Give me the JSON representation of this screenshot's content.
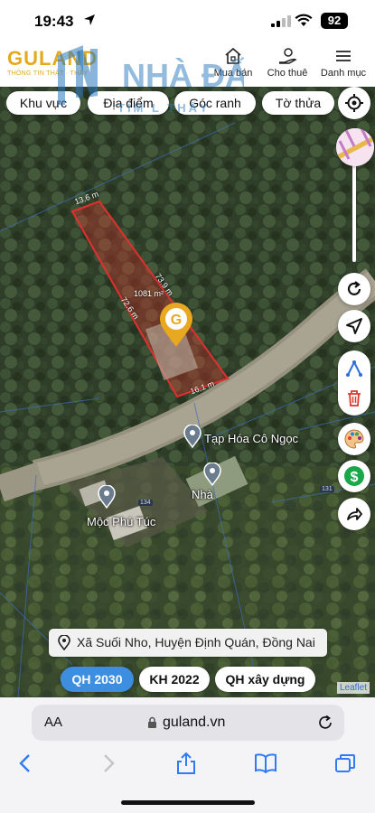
{
  "status": {
    "time": "19:43",
    "battery": "92"
  },
  "header": {
    "logo_text": "GULAND",
    "logo_subtitle": "THÔNG TIN THẬT · THẤY",
    "watermark_line1": "NHÀ ĐẤT",
    "watermark_line2": "TỈM L  THẤY",
    "nav": [
      {
        "label": "Mua bán",
        "icon": "house-icon"
      },
      {
        "label": "Cho thuê",
        "icon": "rent-hand-icon"
      },
      {
        "label": "Danh mục",
        "icon": "menu-icon"
      }
    ]
  },
  "filters": [
    "Khu vực",
    "Địa điểm",
    "Góc ranh",
    "Tờ thửa"
  ],
  "map": {
    "parcel": {
      "area": "1081 m²",
      "edge_top": "13.6 m",
      "edge_right": "73.9 m",
      "edge_left": "72.6 m",
      "edge_bottom": "16.1 m",
      "color": "#e0302f"
    },
    "pois": [
      {
        "name": "Tạp Hóa Cô Ngọc"
      },
      {
        "name": "Nhà"
      },
      {
        "name": "Mộc Phú Túc"
      }
    ],
    "road_numbers": [
      "134",
      "131"
    ],
    "side_buttons": [
      "reload-icon",
      "locate-arrow-icon",
      "draw-measure-icon",
      "trash-icon",
      "palette-icon",
      "dollar-icon",
      "share-icon"
    ],
    "address": "Xã Suối Nho, Huyện Định Quán, Đồng Nai",
    "attribution": "Leaflet"
  },
  "plans": [
    {
      "label": "QH 2030",
      "active": true
    },
    {
      "label": "KH 2022",
      "active": false
    },
    {
      "label": "QH xây dựng",
      "active": false
    }
  ],
  "browser": {
    "aa_label": "AA",
    "url": "guland.vn"
  },
  "colors": {
    "brand": "#e5a91c",
    "active_plan": "#3d8ee0",
    "marker": "#e8a820",
    "icon_blue": "#2d6fd6",
    "icon_red": "#d93a2f",
    "icon_green": "#18a84a"
  }
}
